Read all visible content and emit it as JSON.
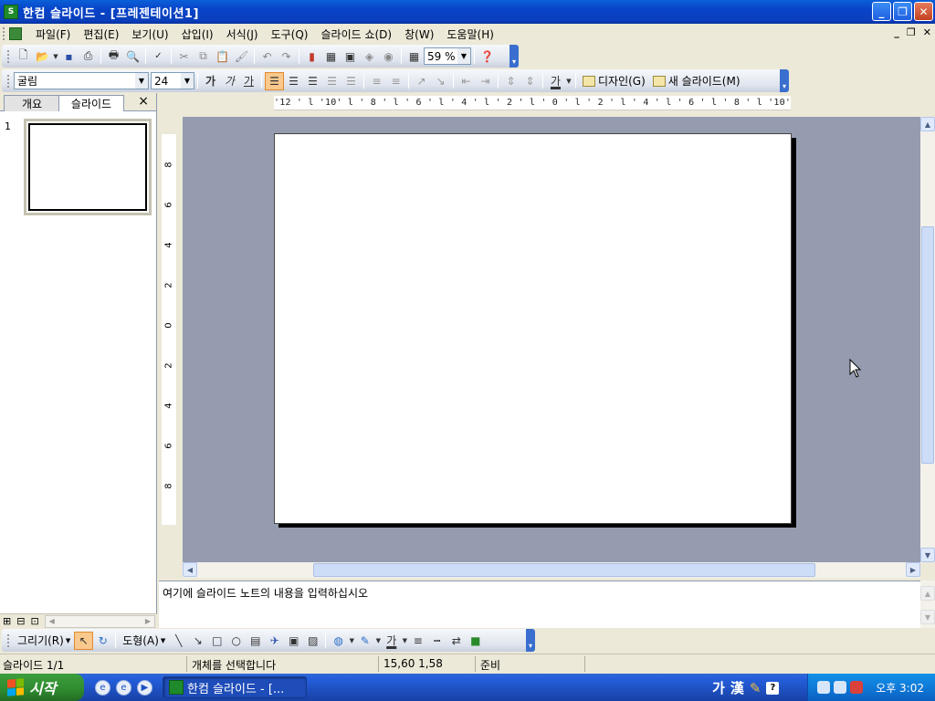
{
  "window": {
    "title": "한컴 슬라이드 - [프레젠테이션1]",
    "app_icon_text": "S"
  },
  "menu": {
    "items": [
      "파일(F)",
      "편집(E)",
      "보기(U)",
      "삽입(I)",
      "서식(J)",
      "도구(Q)",
      "슬라이드 쇼(D)",
      "창(W)",
      "도움말(H)"
    ]
  },
  "standard_toolbar": {
    "zoom": "59 %"
  },
  "format_toolbar": {
    "font_name": "굴림",
    "font_size": "24",
    "bold_label": "가",
    "italic_label": "가",
    "underline_label": "가",
    "font_color_label": "가",
    "design_label": "디자인(G)",
    "new_slide_label": "새 슬라이드(M)"
  },
  "left_panel": {
    "tab_outline": "개요",
    "tab_slides": "슬라이드",
    "close": "×",
    "slide_number": "1"
  },
  "ruler": {
    "horizontal": "'12 ' l '10' l ' 8 ' l ' 6 ' l ' 4 ' l ' 2 ' l ' 0 ' l ' 2 ' l ' 4 ' l ' 6 ' l ' 8 ' l '10' l '12",
    "vertical": [
      "8",
      "6",
      "4",
      "2",
      "0",
      "2",
      "4",
      "6",
      "8"
    ]
  },
  "notes": {
    "text": "여기에 슬라이드 노트의 내용을 입력하십시오"
  },
  "drawing_toolbar": {
    "draw_label": "그리기(R)",
    "autoshape_label": "도형(A)",
    "font_color_label": "가"
  },
  "status": {
    "slide": "슬라이드 1/1",
    "message": "개체를 선택합니다",
    "position": "15,60 1,58",
    "state": "준비"
  },
  "taskbar": {
    "start_label": "시작",
    "task_label": "한컴 슬라이드 - [...",
    "lang_ga": "가",
    "lang_han": "漢",
    "clock": "오후 3:02"
  }
}
